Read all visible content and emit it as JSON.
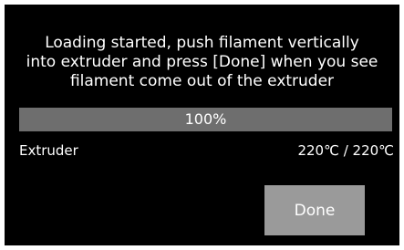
{
  "message": {
    "line1": "Loading started, push filament vertically",
    "line2": "into extruder and press [Done] when you see",
    "line3": "filament come out of the extruder"
  },
  "progress": {
    "label": "100%",
    "value": 1.0
  },
  "extruder": {
    "label": "Extruder",
    "temperature": "220℃ / 220℃"
  },
  "done_button": {
    "label": "Done"
  },
  "colors": {
    "background": "#000000",
    "progress_track": "#3a3a3a",
    "progress_fill": "#6e6e6e",
    "button": "#9a9a9a",
    "text": "#ffffff"
  }
}
